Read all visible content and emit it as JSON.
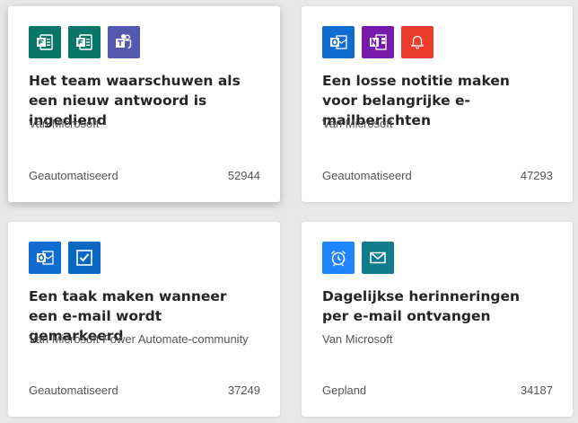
{
  "colors": {
    "forms": "#077568",
    "teams": "#5558af",
    "outlook": "#0f6cd1",
    "onenote": "#7719aa",
    "notification": "#eb3c2d",
    "todo": "#0b67c4",
    "schedule": "#1f85ff",
    "mail": "#0f7c8e"
  },
  "cards": [
    {
      "title": "Het team waarschuwen als een nieuw antwoord is ingediend",
      "author": "Van Microsoft",
      "type": "Geautomatiseerd",
      "count": "52944",
      "icons": [
        "forms-icon",
        "forms-icon",
        "teams-icon"
      ]
    },
    {
      "title": "Een losse notitie maken voor belangrijke e-mailberichten",
      "author": "Van Microsoft",
      "type": "Geautomatiseerd",
      "count": "47293",
      "icons": [
        "outlook-icon",
        "onenote-icon",
        "notification-bell-icon"
      ]
    },
    {
      "title": "Een taak maken wanneer een e-mail wordt gemarkeerd",
      "author": "Van Microsoft Power Automate-community",
      "type": "Geautomatiseerd",
      "count": "37249",
      "icons": [
        "outlook-icon",
        "todo-checkbox-icon"
      ]
    },
    {
      "title": "Dagelijkse herinneringen per e-mail ontvangen",
      "author": "Van Microsoft",
      "type": "Gepland",
      "count": "34187",
      "icons": [
        "alarm-clock-icon",
        "mail-icon"
      ]
    }
  ]
}
